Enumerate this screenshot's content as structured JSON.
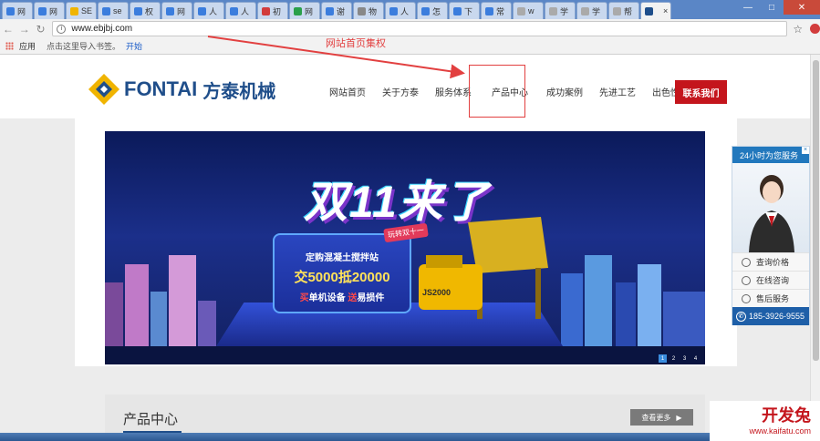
{
  "browser": {
    "tabs": [
      {
        "label": "网",
        "color": "#3b7ddd"
      },
      {
        "label": "网",
        "color": "#3b7ddd"
      },
      {
        "label": "SE",
        "color": "#f0b400"
      },
      {
        "label": "se",
        "color": "#3b7ddd"
      },
      {
        "label": "权",
        "color": "#3b7ddd"
      },
      {
        "label": "网",
        "color": "#3b7ddd"
      },
      {
        "label": "人",
        "color": "#3b7ddd"
      },
      {
        "label": "人",
        "color": "#3b7ddd"
      },
      {
        "label": "初",
        "color": "#d23c3c"
      },
      {
        "label": "网",
        "color": "#2aa04a"
      },
      {
        "label": "谢",
        "color": "#3b7ddd"
      },
      {
        "label": "物",
        "color": "#888888"
      },
      {
        "label": "人",
        "color": "#3b7ddd"
      },
      {
        "label": "怎",
        "color": "#3b7ddd"
      },
      {
        "label": "下",
        "color": "#3b7ddd"
      },
      {
        "label": "常",
        "color": "#3b7ddd"
      },
      {
        "label": "w",
        "color": "#aaaaaa"
      },
      {
        "label": "学",
        "color": "#aaaaaa"
      },
      {
        "label": "学",
        "color": "#aaaaaa"
      },
      {
        "label": "帮",
        "color": "#aaaaaa"
      },
      {
        "label": "",
        "color": "#1f4e8a",
        "active": true
      }
    ],
    "url": "www.ebjbj.com",
    "bookmarks": {
      "apps_label": "应用",
      "prompt": "点击这里导入书签。",
      "start": "开始"
    }
  },
  "annotation": {
    "text": "网站首页集权"
  },
  "site": {
    "logo_en": "FONTAI",
    "logo_cn": "方泰机械",
    "nav": [
      "网站首页",
      "关于方泰",
      "服务体系",
      "产品中心",
      "成功案例",
      "先进工艺",
      "出色性能"
    ],
    "contact": "联系我们",
    "banner": {
      "title": "双11来了",
      "tag": "玩转双十一",
      "line1": "定购混凝土搅拌站",
      "line2": "交5000抵20000",
      "line3_a": "买",
      "line3_b": "单机设备 ",
      "line3_c": "送",
      "line3_d": "易损件",
      "machine_label": "JS2000",
      "slides": [
        "1",
        "2",
        "3",
        "4"
      ]
    },
    "section": {
      "title": "产品中心",
      "more": "查看更多"
    }
  },
  "service": {
    "header": "24小时为您服务",
    "items": [
      "查询价格",
      "在线咨询",
      "售后服务"
    ],
    "phone": "185-3926-9555"
  },
  "watermark": {
    "cn": "开发兔",
    "en": "www.kaifatu.com"
  }
}
